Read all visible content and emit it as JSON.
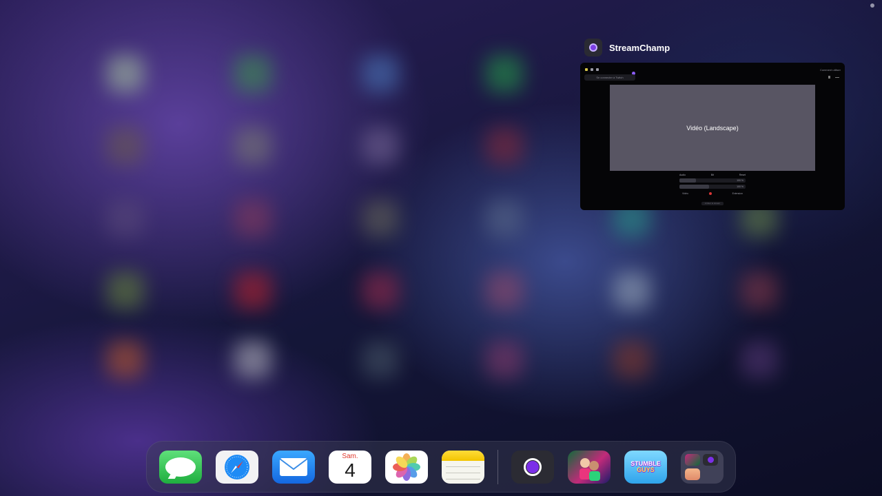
{
  "switcher": {
    "app_name": "StreamChamp",
    "preview": {
      "connect_label": "Se connecter à Twitch",
      "help_label": "Comment utiliser",
      "video_label": "Vidéo (Landscape)",
      "tabs": [
        "Audio",
        "Bit",
        "Reset"
      ],
      "slider1": {
        "value": "100 %",
        "level": 0.25
      },
      "slider2": {
        "value": "100 %",
        "level": 0.45
      },
      "left_label": "Vidéo",
      "right_label": "Extension",
      "bottom_button": "Arrêter le stream"
    }
  },
  "dock": {
    "apps": [
      {
        "name": "Messages",
        "icon": "messages-icon"
      },
      {
        "name": "Safari",
        "icon": "safari-icon"
      },
      {
        "name": "Mail",
        "icon": "mail-icon"
      },
      {
        "name": "Calendrier",
        "icon": "calendar-icon",
        "day_label": "Sam.",
        "date_number": "4"
      },
      {
        "name": "Photos",
        "icon": "photos-icon"
      },
      {
        "name": "Notes",
        "icon": "notes-icon"
      }
    ],
    "recent": [
      {
        "name": "StreamChamp",
        "icon": "streamchamp-icon"
      },
      {
        "name": "eFootball",
        "icon": "efootball-icon"
      },
      {
        "name": "Stumble Guys",
        "icon": "stumble-guys-icon",
        "word1": "STUMBLE",
        "word2": "GUYS"
      },
      {
        "name": "App Library",
        "icon": "app-library-icon"
      }
    ]
  },
  "colors": {
    "accent": "#7b2fe8",
    "card_bg": "#050507",
    "video_bg": "#585563"
  }
}
